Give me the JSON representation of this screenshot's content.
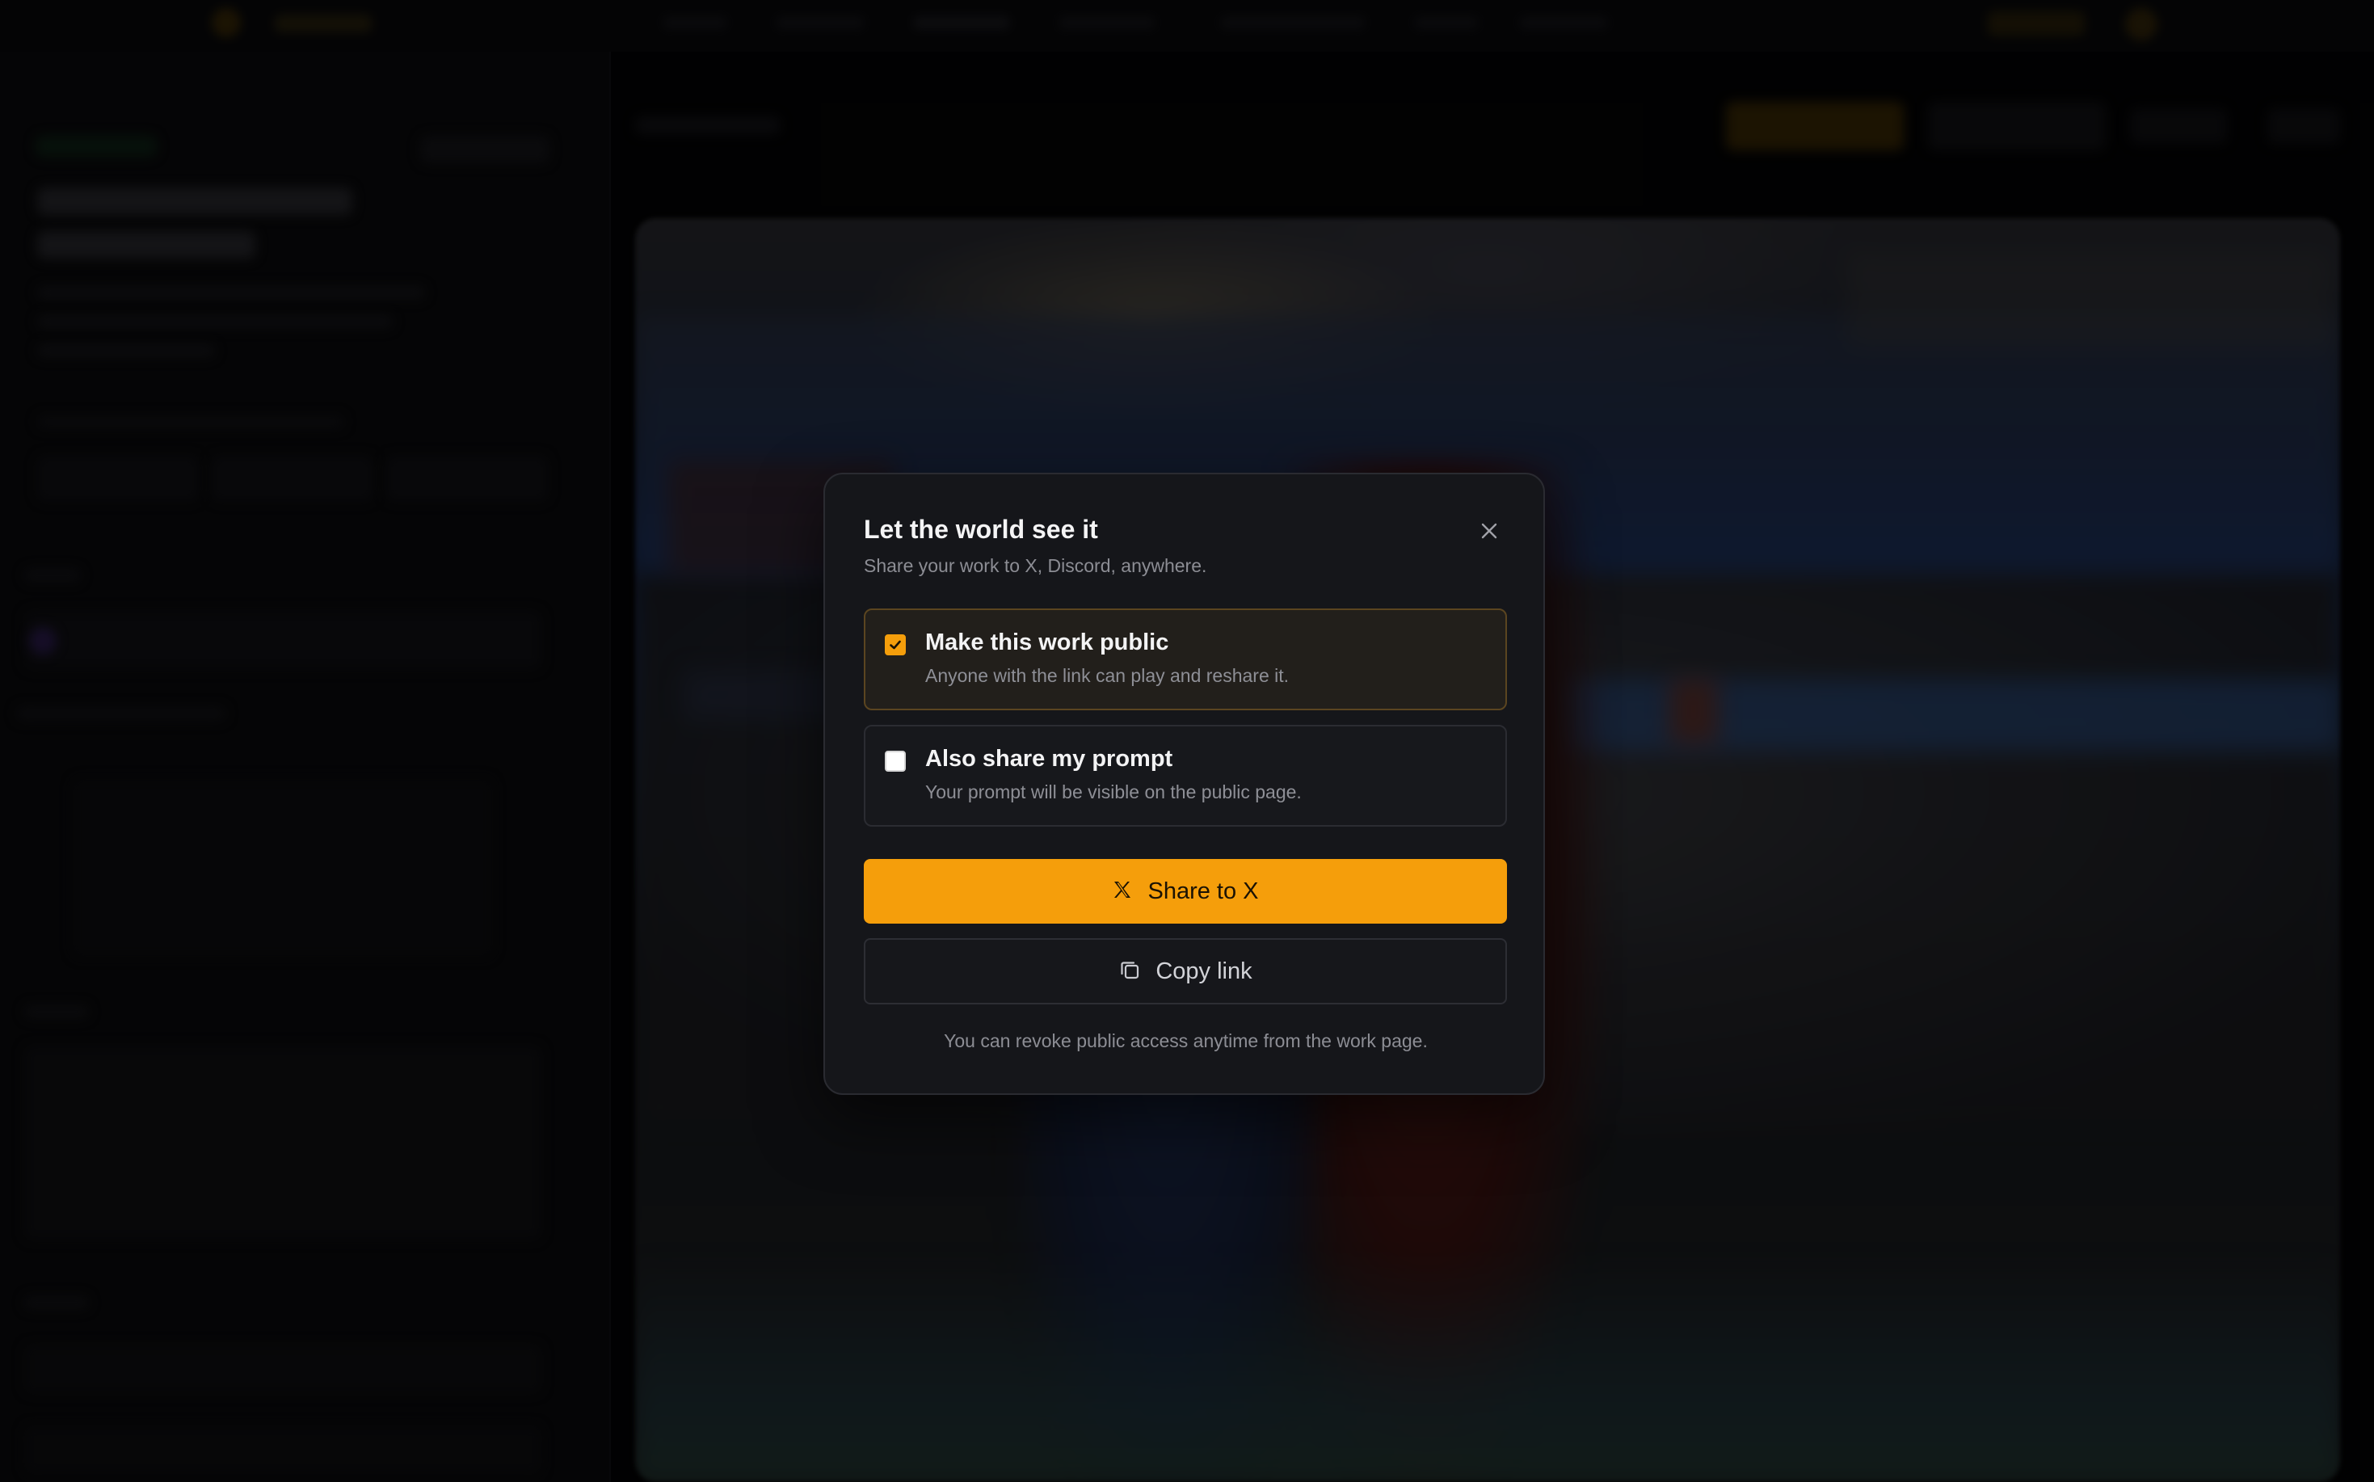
{
  "dialog": {
    "title": "Let the world see it",
    "subtitle": "Share your work to X, Discord, anywhere.",
    "close_icon": "close-icon",
    "options": [
      {
        "title": "Make this work public",
        "description": "Anyone with the link can play and reshare it.",
        "checked": true
      },
      {
        "title": "Also share my prompt",
        "description": "Your prompt will be visible on the public page.",
        "checked": false
      }
    ],
    "share_button": {
      "label": "Share to X",
      "icon": "x-logo-icon"
    },
    "copy_button": {
      "label": "Copy link",
      "icon": "copy-icon"
    },
    "footer": "You can revoke public access anytime from the work page."
  },
  "colors": {
    "accent": "#f59e0b",
    "dialog_bg": "#15161a",
    "overlay": "rgba(0,0,0,0.52)"
  }
}
